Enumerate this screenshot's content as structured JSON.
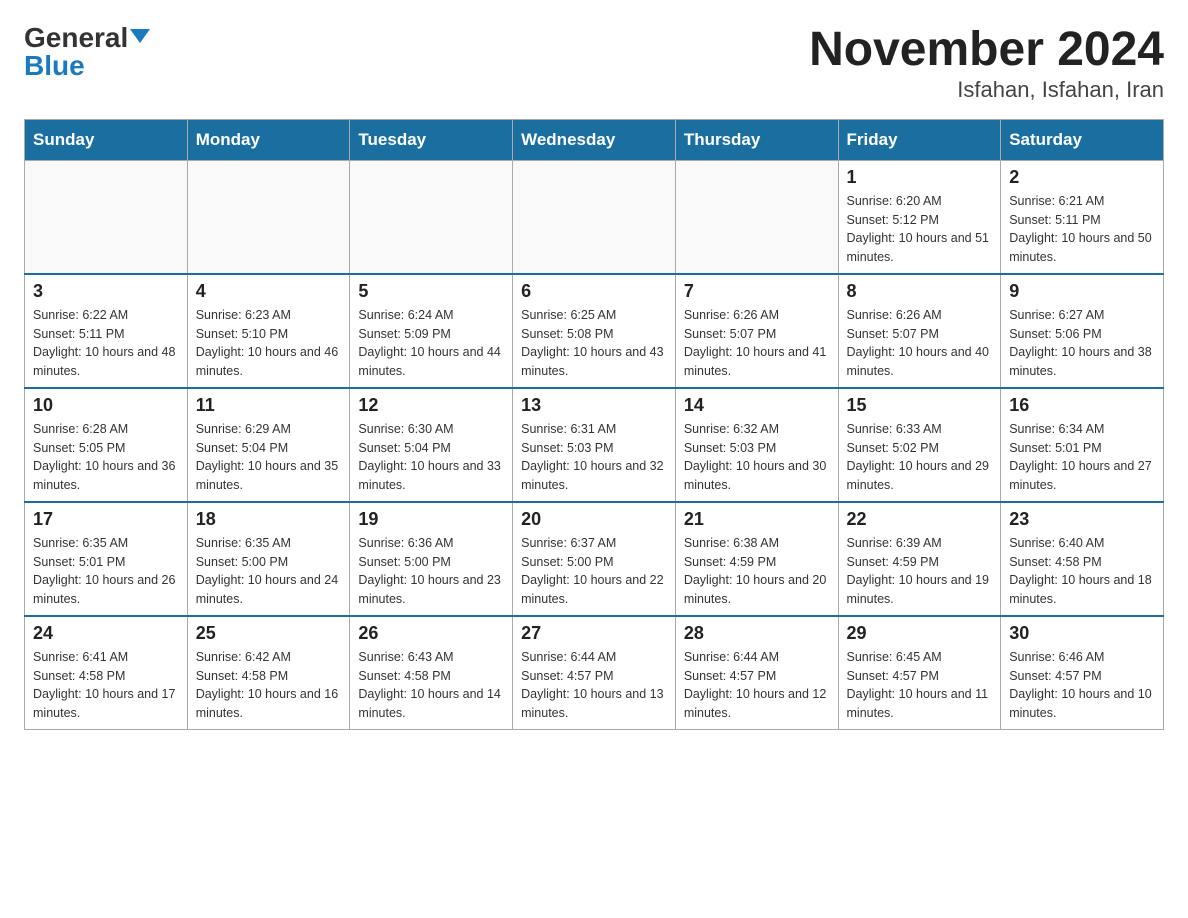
{
  "header": {
    "logo_general": "General",
    "logo_blue": "Blue",
    "title": "November 2024",
    "subtitle": "Isfahan, Isfahan, Iran"
  },
  "weekdays": [
    "Sunday",
    "Monday",
    "Tuesday",
    "Wednesday",
    "Thursday",
    "Friday",
    "Saturday"
  ],
  "weeks": [
    [
      {
        "day": "",
        "info": ""
      },
      {
        "day": "",
        "info": ""
      },
      {
        "day": "",
        "info": ""
      },
      {
        "day": "",
        "info": ""
      },
      {
        "day": "",
        "info": ""
      },
      {
        "day": "1",
        "info": "Sunrise: 6:20 AM\nSunset: 5:12 PM\nDaylight: 10 hours and 51 minutes."
      },
      {
        "day": "2",
        "info": "Sunrise: 6:21 AM\nSunset: 5:11 PM\nDaylight: 10 hours and 50 minutes."
      }
    ],
    [
      {
        "day": "3",
        "info": "Sunrise: 6:22 AM\nSunset: 5:11 PM\nDaylight: 10 hours and 48 minutes."
      },
      {
        "day": "4",
        "info": "Sunrise: 6:23 AM\nSunset: 5:10 PM\nDaylight: 10 hours and 46 minutes."
      },
      {
        "day": "5",
        "info": "Sunrise: 6:24 AM\nSunset: 5:09 PM\nDaylight: 10 hours and 44 minutes."
      },
      {
        "day": "6",
        "info": "Sunrise: 6:25 AM\nSunset: 5:08 PM\nDaylight: 10 hours and 43 minutes."
      },
      {
        "day": "7",
        "info": "Sunrise: 6:26 AM\nSunset: 5:07 PM\nDaylight: 10 hours and 41 minutes."
      },
      {
        "day": "8",
        "info": "Sunrise: 6:26 AM\nSunset: 5:07 PM\nDaylight: 10 hours and 40 minutes."
      },
      {
        "day": "9",
        "info": "Sunrise: 6:27 AM\nSunset: 5:06 PM\nDaylight: 10 hours and 38 minutes."
      }
    ],
    [
      {
        "day": "10",
        "info": "Sunrise: 6:28 AM\nSunset: 5:05 PM\nDaylight: 10 hours and 36 minutes."
      },
      {
        "day": "11",
        "info": "Sunrise: 6:29 AM\nSunset: 5:04 PM\nDaylight: 10 hours and 35 minutes."
      },
      {
        "day": "12",
        "info": "Sunrise: 6:30 AM\nSunset: 5:04 PM\nDaylight: 10 hours and 33 minutes."
      },
      {
        "day": "13",
        "info": "Sunrise: 6:31 AM\nSunset: 5:03 PM\nDaylight: 10 hours and 32 minutes."
      },
      {
        "day": "14",
        "info": "Sunrise: 6:32 AM\nSunset: 5:03 PM\nDaylight: 10 hours and 30 minutes."
      },
      {
        "day": "15",
        "info": "Sunrise: 6:33 AM\nSunset: 5:02 PM\nDaylight: 10 hours and 29 minutes."
      },
      {
        "day": "16",
        "info": "Sunrise: 6:34 AM\nSunset: 5:01 PM\nDaylight: 10 hours and 27 minutes."
      }
    ],
    [
      {
        "day": "17",
        "info": "Sunrise: 6:35 AM\nSunset: 5:01 PM\nDaylight: 10 hours and 26 minutes."
      },
      {
        "day": "18",
        "info": "Sunrise: 6:35 AM\nSunset: 5:00 PM\nDaylight: 10 hours and 24 minutes."
      },
      {
        "day": "19",
        "info": "Sunrise: 6:36 AM\nSunset: 5:00 PM\nDaylight: 10 hours and 23 minutes."
      },
      {
        "day": "20",
        "info": "Sunrise: 6:37 AM\nSunset: 5:00 PM\nDaylight: 10 hours and 22 minutes."
      },
      {
        "day": "21",
        "info": "Sunrise: 6:38 AM\nSunset: 4:59 PM\nDaylight: 10 hours and 20 minutes."
      },
      {
        "day": "22",
        "info": "Sunrise: 6:39 AM\nSunset: 4:59 PM\nDaylight: 10 hours and 19 minutes."
      },
      {
        "day": "23",
        "info": "Sunrise: 6:40 AM\nSunset: 4:58 PM\nDaylight: 10 hours and 18 minutes."
      }
    ],
    [
      {
        "day": "24",
        "info": "Sunrise: 6:41 AM\nSunset: 4:58 PM\nDaylight: 10 hours and 17 minutes."
      },
      {
        "day": "25",
        "info": "Sunrise: 6:42 AM\nSunset: 4:58 PM\nDaylight: 10 hours and 16 minutes."
      },
      {
        "day": "26",
        "info": "Sunrise: 6:43 AM\nSunset: 4:58 PM\nDaylight: 10 hours and 14 minutes."
      },
      {
        "day": "27",
        "info": "Sunrise: 6:44 AM\nSunset: 4:57 PM\nDaylight: 10 hours and 13 minutes."
      },
      {
        "day": "28",
        "info": "Sunrise: 6:44 AM\nSunset: 4:57 PM\nDaylight: 10 hours and 12 minutes."
      },
      {
        "day": "29",
        "info": "Sunrise: 6:45 AM\nSunset: 4:57 PM\nDaylight: 10 hours and 11 minutes."
      },
      {
        "day": "30",
        "info": "Sunrise: 6:46 AM\nSunset: 4:57 PM\nDaylight: 10 hours and 10 minutes."
      }
    ]
  ]
}
